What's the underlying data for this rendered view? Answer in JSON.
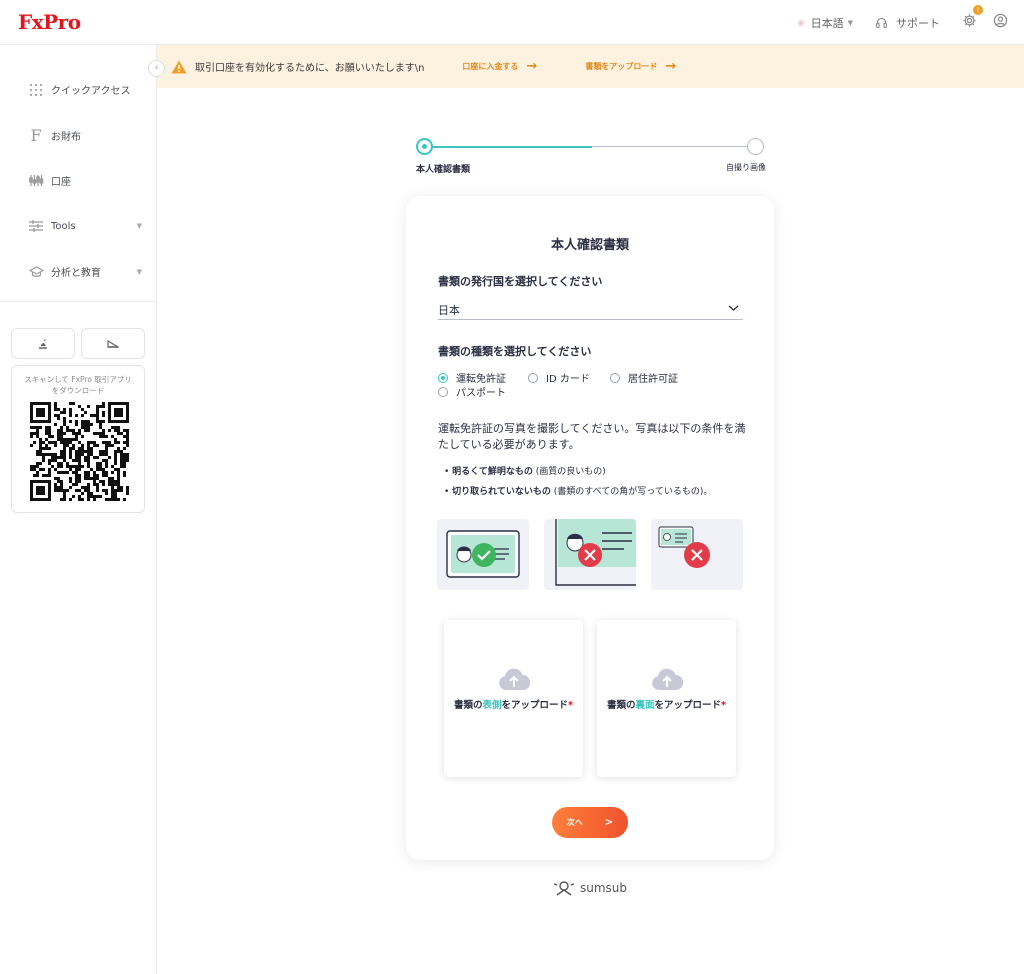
{
  "brand": {
    "logo": "FxPro"
  },
  "header": {
    "language": "日本語",
    "support": "サポート",
    "notification_count": "!"
  },
  "sidebar": {
    "items": [
      {
        "label": "クイックアクセス",
        "icon": "grid-icon"
      },
      {
        "label": "お財布",
        "icon": "wallet-f-icon"
      },
      {
        "label": "口座",
        "icon": "accounts-icon"
      },
      {
        "label": "Tools",
        "icon": "tools-sliders-icon"
      },
      {
        "label": "分析と教育",
        "icon": "education-cap-icon"
      }
    ],
    "qr_text": "スキャンして FxPro 取引アプリをダウンロード"
  },
  "banner": {
    "message": "取引口座を有効化するために、お願いいたします\\n",
    "link_deposit": "口座に入金する",
    "link_upload": "書類をアップロード"
  },
  "stepper": {
    "step1": "本人確認書類",
    "step2": "自撮り画像"
  },
  "card": {
    "title": "本人確認書類",
    "country_label": "書類の発行国を選択してください",
    "country_value": "日本",
    "doctype_label": "書類の種類を選択してください",
    "doctypes": [
      {
        "label": "運転免許証",
        "selected": true
      },
      {
        "label": "ID カード",
        "selected": false
      },
      {
        "label": "居住許可証",
        "selected": false
      },
      {
        "label": "パスポート",
        "selected": false
      }
    ],
    "instruction": "運転免許証の写真を撮影してください。写真は以下の条件を満たしている必要があります。",
    "bullets": [
      {
        "bold": "明るくて鮮明なもの",
        "rest": " (画質の良いもの)"
      },
      {
        "bold": "切り取られていないもの",
        "rest": " (書類のすべての角が写っているもの)。"
      }
    ],
    "upload_front": {
      "pre": "書類の",
      "hl": "表側",
      "post": "をアップロード",
      "star": "*"
    },
    "upload_back": {
      "pre": "書類の",
      "hl": "裏面",
      "post": "をアップロード",
      "star": "*"
    },
    "next_label": "次へ",
    "next_arrow": ">"
  },
  "footer": {
    "powered": "sumsub"
  },
  "colors": {
    "brand_red": "#e2141c",
    "accent_teal": "#39c6c0",
    "cta_orange": "#f0522d",
    "banner_bg": "#fdf2e0"
  }
}
